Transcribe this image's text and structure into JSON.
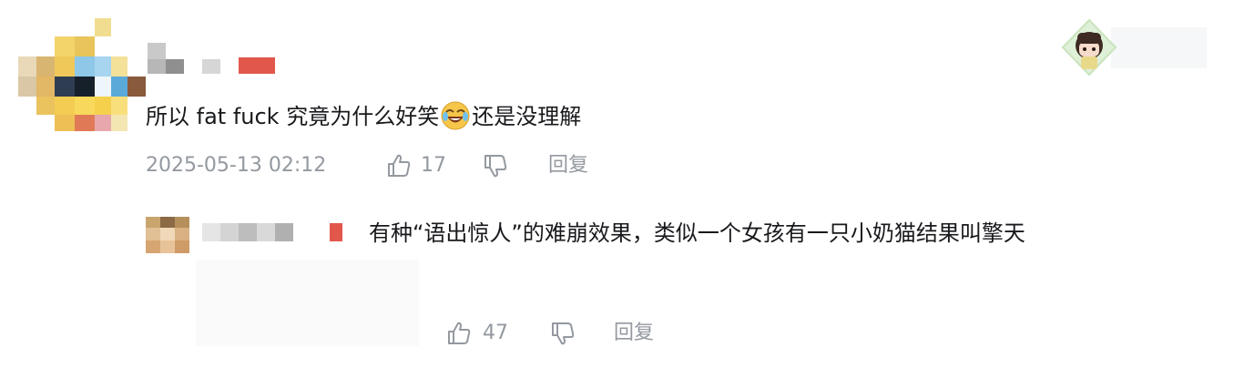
{
  "comment": {
    "text_before_emoji": "所以 fat fuck 究竟为什么好笑",
    "emoji": "laughing-crying-emoji",
    "text_after_emoji": "还是没理解",
    "timestamp": "2025-05-13 02:12",
    "like_count": "17",
    "reply_label": "回复"
  },
  "reply": {
    "text": "有种“语出惊人”的难崩效果，类似一个女孩有一只小奶猫结果叫擎天",
    "like_count": "47",
    "reply_label": "回复"
  },
  "colors": {
    "meta_gray": "#9499a0",
    "text": "#18191c",
    "censor_red": "#e2574c"
  }
}
